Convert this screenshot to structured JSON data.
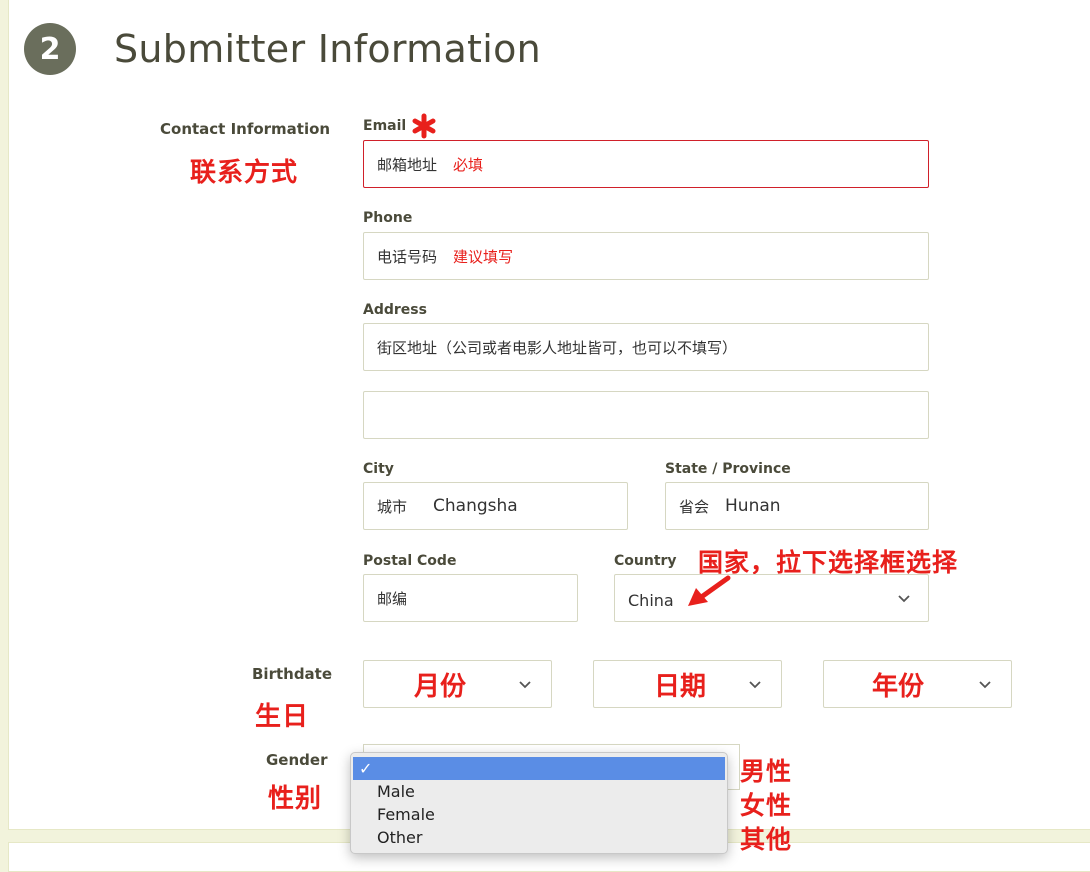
{
  "section": {
    "number": "2",
    "title": "Submitter Information"
  },
  "contact": {
    "label": "Contact Information",
    "annotation": "联系方式",
    "email": {
      "label": "Email",
      "placeholder": "邮箱地址",
      "note": "必填"
    },
    "phone": {
      "label": "Phone",
      "placeholder": "电话号码",
      "note": "建议填写"
    },
    "address": {
      "label": "Address",
      "line1": "街区地址（公司或者电影人地址皆可，也可以不填写）",
      "line2": ""
    },
    "city": {
      "label": "City",
      "hint": "城市",
      "value": "Changsha"
    },
    "state": {
      "label": "State / Province",
      "hint": "省会",
      "value": "Hunan"
    },
    "postal": {
      "label": "Postal Code",
      "hint": "邮编"
    },
    "country": {
      "label": "Country",
      "value": "China",
      "annotation": "国家，拉下选择框选择"
    }
  },
  "birthdate": {
    "label": "Birthdate",
    "annotation": "生日",
    "month": "月份",
    "day": "日期",
    "year": "年份"
  },
  "gender": {
    "label": "Gender",
    "annotation": "性别",
    "options": [
      {
        "value": "",
        "selected": true,
        "check": "✓"
      },
      {
        "value": "Male",
        "note": "男性"
      },
      {
        "value": "Female",
        "note": "女性"
      },
      {
        "value": "Other",
        "note": "其他"
      }
    ]
  },
  "colors": {
    "accent_red": "#e8201c",
    "error_border": "#d0202a",
    "badge": "#6a6e5c",
    "highlight": "#5a8de5"
  },
  "icons": {
    "required": "asterisk-icon",
    "select": "chevron-down-icon",
    "pointer": "arrow-icon",
    "selected": "checkmark-icon"
  }
}
